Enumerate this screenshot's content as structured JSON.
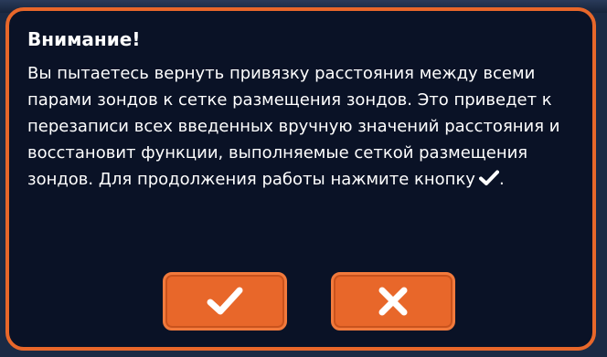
{
  "dialog": {
    "title": "Внимание!",
    "message": "Вы пытаетесь вернуть привязку расстояния между всеми парами зондов к сетке размещения зондов. Это приведет к перезаписи всех введенных вручную значений расстояния и восстановит функции, выполняемые сеткой размещения зондов. Для продолжения работы нажмите кнопку",
    "message_end": ".",
    "message_icon": "check-icon",
    "confirm_icon": "check-icon",
    "cancel_icon": "close-icon"
  },
  "colors": {
    "accent": "#e8672a",
    "dialog_bg": "#0a1226",
    "text": "#ffffff"
  }
}
